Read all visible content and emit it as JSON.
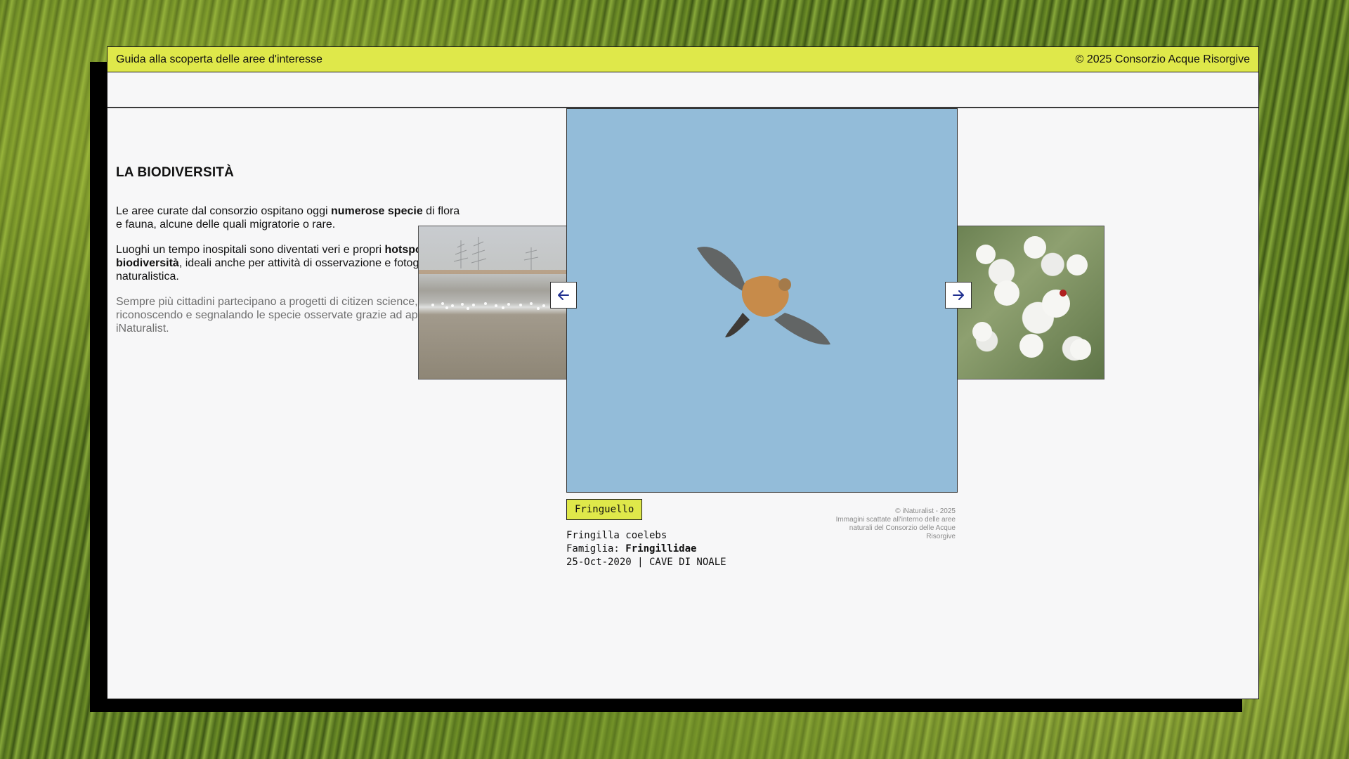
{
  "header": {
    "left_title": "Guida alla scoperta delle aree d'interesse",
    "right_copyright": "© 2025 Consorzio Acque Risorgive"
  },
  "section": {
    "title": "LA BIODIVERSITÀ",
    "p1_a": "Le aree curate dal consorzio ospitano oggi ",
    "p1_bold": "numerose specie",
    "p1_b": " di flora e fauna, alcune delle quali migratorie o rare.",
    "p2_a": "Luoghi un tempo inospitali sono diventati veri e propri ",
    "p2_bold": "hotspot di biodiversità",
    "p2_b": ", ideali anche per attività di osservazione e fotografia naturalistica.",
    "p3": "Sempre più cittadini partecipano a progetti di citizen science, riconoscendo e segnalando le specie osservate grazie ad app come iNaturalist."
  },
  "gallery": {
    "prev_icon": "arrow-left-icon",
    "next_icon": "arrow-right-icon",
    "species_common": "Fringuello",
    "species_latin": "Fringilla coelebs",
    "family_label": "Famiglia: ",
    "family_value": "Fringillidae",
    "date_location": "25-Oct-2020 | CAVE DI NOALE",
    "credit_line1": "© iNaturalist - 2025",
    "credit_line2": "Immagini scattate all'interno delle aree naturali del Consorzio delle Acque Risorgive"
  },
  "colors": {
    "accent": "#dfe84a",
    "sky": "#93bcd9",
    "nav_arrow": "#1f2f8f"
  }
}
